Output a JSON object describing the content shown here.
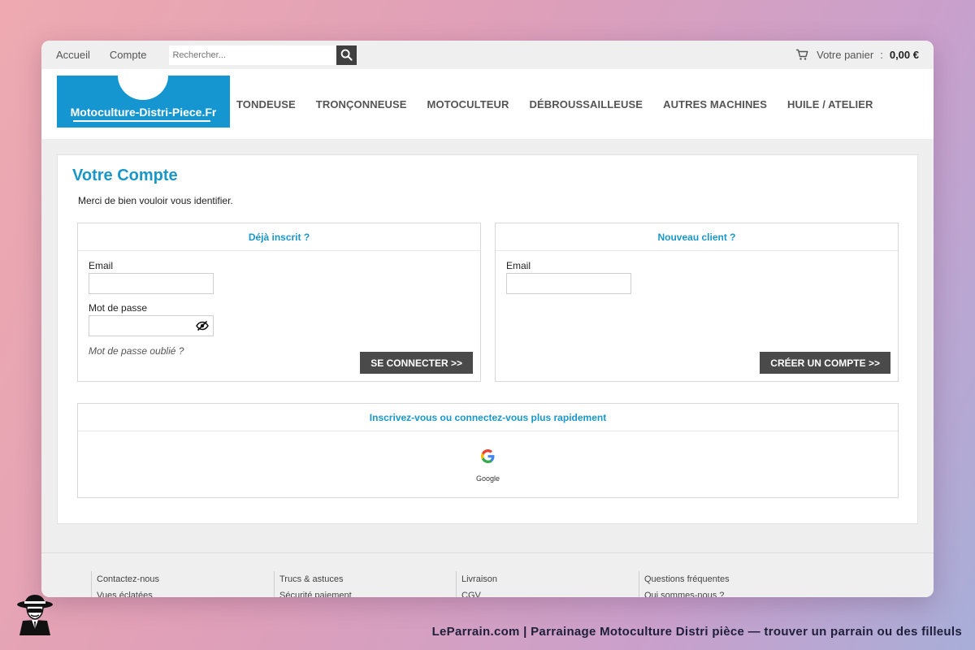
{
  "topbar": {
    "nav": [
      "Accueil",
      "Compte"
    ],
    "search_placeholder": "Rechercher...",
    "search_icon": "search-icon",
    "cart": {
      "icon": "cart-icon",
      "label": "Votre panier",
      "separator": ":",
      "amount": "0,00 €"
    }
  },
  "header": {
    "logo_text": "Motoculture-Distri-Piece.Fr",
    "nav": [
      "TONDEUSE",
      "TRONÇONNEUSE",
      "MOTOCULTEUR",
      "DÉBROUSSAILLEUSE",
      "AUTRES MACHINES",
      "HUILE / ATELIER"
    ]
  },
  "account": {
    "title": "Votre Compte",
    "intro": "Merci de bien vouloir vous identifier.",
    "login": {
      "heading": "Déjà inscrit ?",
      "email_label": "Email",
      "email_value": "",
      "password_label": "Mot de passe",
      "password_value": "",
      "password_toggle_icon": "eye-off-icon",
      "forgot": "Mot de passe oublié ?",
      "submit": "SE CONNECTER >>"
    },
    "register": {
      "heading": "Nouveau client ?",
      "email_label": "Email",
      "email_value": "",
      "submit": "CRÉER UN COMPTE >>"
    },
    "social": {
      "heading": "Inscrivez-vous ou connectez-vous plus rapidement",
      "provider_icon": "google-icon",
      "provider_label": "Google"
    }
  },
  "footer": {
    "columns": [
      [
        "Contactez-nous",
        "Vues éclatées"
      ],
      [
        "Trucs & astuces",
        "Sécurité paiement"
      ],
      [
        "Livraison",
        "CGV"
      ],
      [
        "Questions fréquentes",
        "Qui sommes-nous ?"
      ]
    ]
  },
  "caption": {
    "mascot_icon": "detective-mascot-icon",
    "text": "LeParrain.com | Parrainage Motoculture Distri pièce — trouver un parrain ou des filleuls"
  },
  "colors": {
    "accent": "#1a97c9",
    "logo_bg": "#1596d1",
    "button_bg": "#4a4a4a"
  }
}
